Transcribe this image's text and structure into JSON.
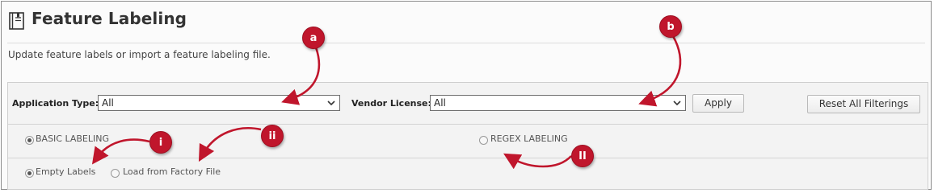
{
  "header": {
    "title": "Feature Labeling",
    "description": "Update feature labels or import a feature labeling file."
  },
  "filters": {
    "application_type_label": "Application Type:",
    "application_type_value": "All",
    "vendor_license_label": "Vendor License:",
    "vendor_license_value": "All",
    "apply_label": "Apply",
    "reset_label": "Reset All Filterings"
  },
  "labeling_mode": {
    "basic_label": "BASIC LABELING",
    "regex_label": "REGEX LABELING",
    "selected": "BASIC LABELING"
  },
  "basic_options": {
    "empty_labels": "Empty Labels",
    "load_factory": "Load from Factory File",
    "selected": "Empty Labels"
  },
  "callouts": {
    "a": "a",
    "b": "b",
    "i": "i",
    "ii": "ii",
    "II": "II"
  },
  "colors": {
    "callout": "#c0162c",
    "panel_bg": "#f3f3f3",
    "border": "#cfcfcf"
  }
}
